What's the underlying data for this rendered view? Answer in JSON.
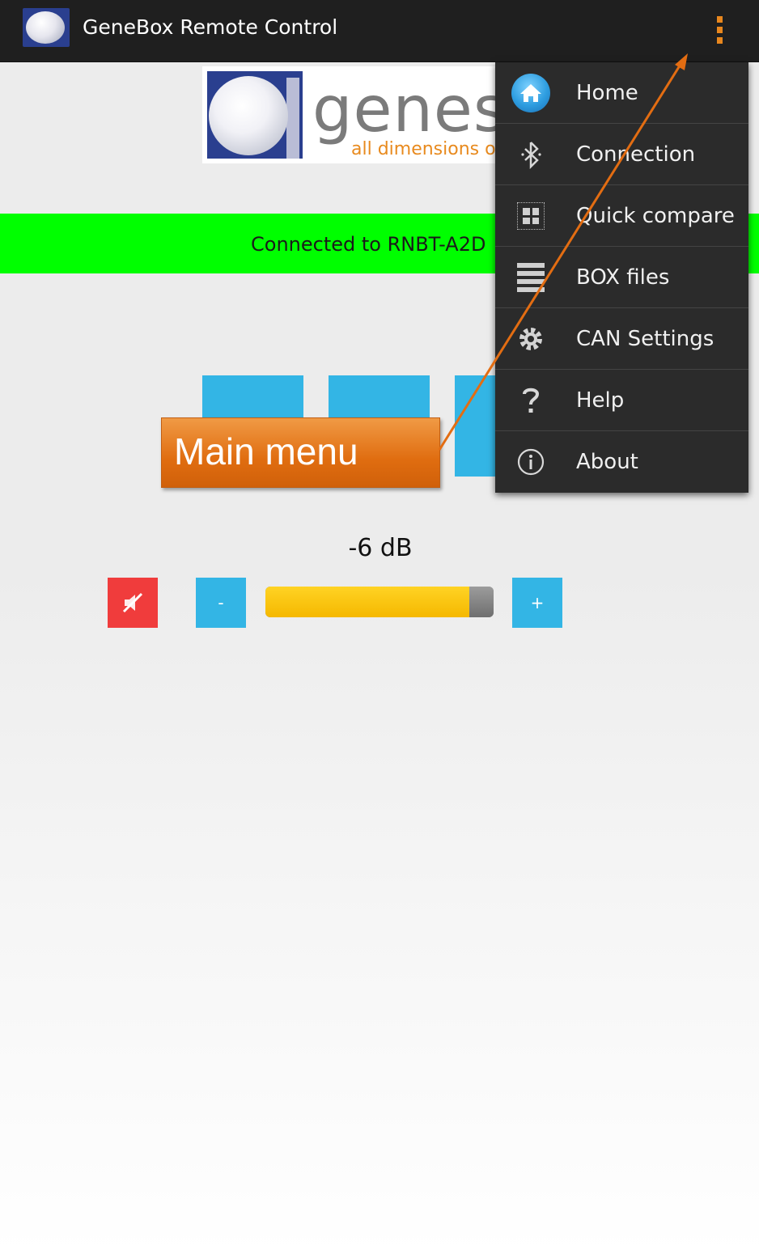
{
  "action_bar": {
    "title": "GeneBox Remote Control",
    "overflow_icon": "overflow-menu-icon",
    "accent_color": "#e8871e"
  },
  "logo": {
    "word": "genes",
    "tagline": "all dimensions of"
  },
  "banner": {
    "text": "Connected to RNBT-A2D",
    "color": "#00ff00"
  },
  "controls": {
    "button_color": "#33b5e5"
  },
  "volume": {
    "label": "-6 dB",
    "minus_label": "-",
    "plus_label": "+",
    "mute_icon": "mute-speaker-icon",
    "level_fraction": 0.9,
    "mute_color": "#f03c3c"
  },
  "annotation": {
    "text": "Main menu",
    "color": "#e06d10"
  },
  "menu": {
    "items": [
      {
        "label": "Home",
        "icon": "home-icon"
      },
      {
        "label": "Connection",
        "icon": "bluetooth-icon"
      },
      {
        "label": "Quick compare",
        "icon": "grid-icon"
      },
      {
        "label": "BOX files",
        "icon": "files-icon"
      },
      {
        "label": "CAN Settings",
        "icon": "gear-icon"
      },
      {
        "label": "Help",
        "icon": "help-icon"
      },
      {
        "label": "About",
        "icon": "info-icon"
      }
    ]
  }
}
